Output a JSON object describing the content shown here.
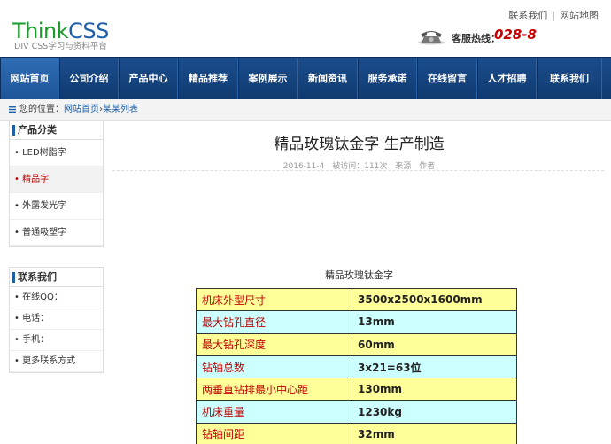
{
  "header": {
    "logo_think": "Think",
    "logo_css": "CSS",
    "logo_sub": "DIV CSS学习与资料平台",
    "top_links": [
      "联系我们",
      "网站地图"
    ],
    "hotline_label": "客服热线：",
    "hotline_number": "028-8"
  },
  "nav": {
    "items": [
      "网站首页",
      "公司介绍",
      "产品中心",
      "精品推荐",
      "案例展示",
      "新闻资讯",
      "服务承诺",
      "在线留言",
      "人才招聘",
      "联系我们"
    ],
    "active_index": 0
  },
  "breadcrumb": {
    "prefix": "您的位置：",
    "home": "网站首页",
    "sep": "›",
    "current": "某某列表"
  },
  "sidebar": {
    "categories_title": "产品分类",
    "categories": [
      "• LED树脂字",
      "• 精品字",
      "• 外露发光字",
      "• 普通吸塑字"
    ],
    "active_category": 1,
    "contact_title": "联系我们",
    "contact": [
      "• 在线QQ：",
      "• 电话：",
      "• 手机：",
      "• 更多联系方式"
    ]
  },
  "article": {
    "title": "精品玫瑰钛金字 生产制造",
    "date": "2016-11-4",
    "views": "被访问：111次",
    "source": "来源",
    "author": "作者",
    "caption": "精品玫瑰钛金字",
    "specs": [
      {
        "key": "机床外型尺寸",
        "value": "3500x2500x1600mm",
        "color": "#ffff99"
      },
      {
        "key": "最大钻孔直径",
        "value": "13mm",
        "color": "#ccffff"
      },
      {
        "key": "最大钻孔深度",
        "value": "60mm",
        "color": "#ffff99"
      },
      {
        "key": "钻轴总数",
        "value": "3x21=63位",
        "color": "#ccffff"
      },
      {
        "key": "两垂直钻排最小中心距",
        "value": "130mm",
        "color": "#ffff99"
      },
      {
        "key": "机床重量",
        "value": "1230kg",
        "color": "#ccffff"
      },
      {
        "key": "钻轴间距",
        "value": "32mm",
        "color": "#ffff99"
      }
    ]
  },
  "colors": {
    "nav_bg": "#1b4d8c",
    "accent_red": "#c00000",
    "link_blue": "#1f5fa8"
  }
}
